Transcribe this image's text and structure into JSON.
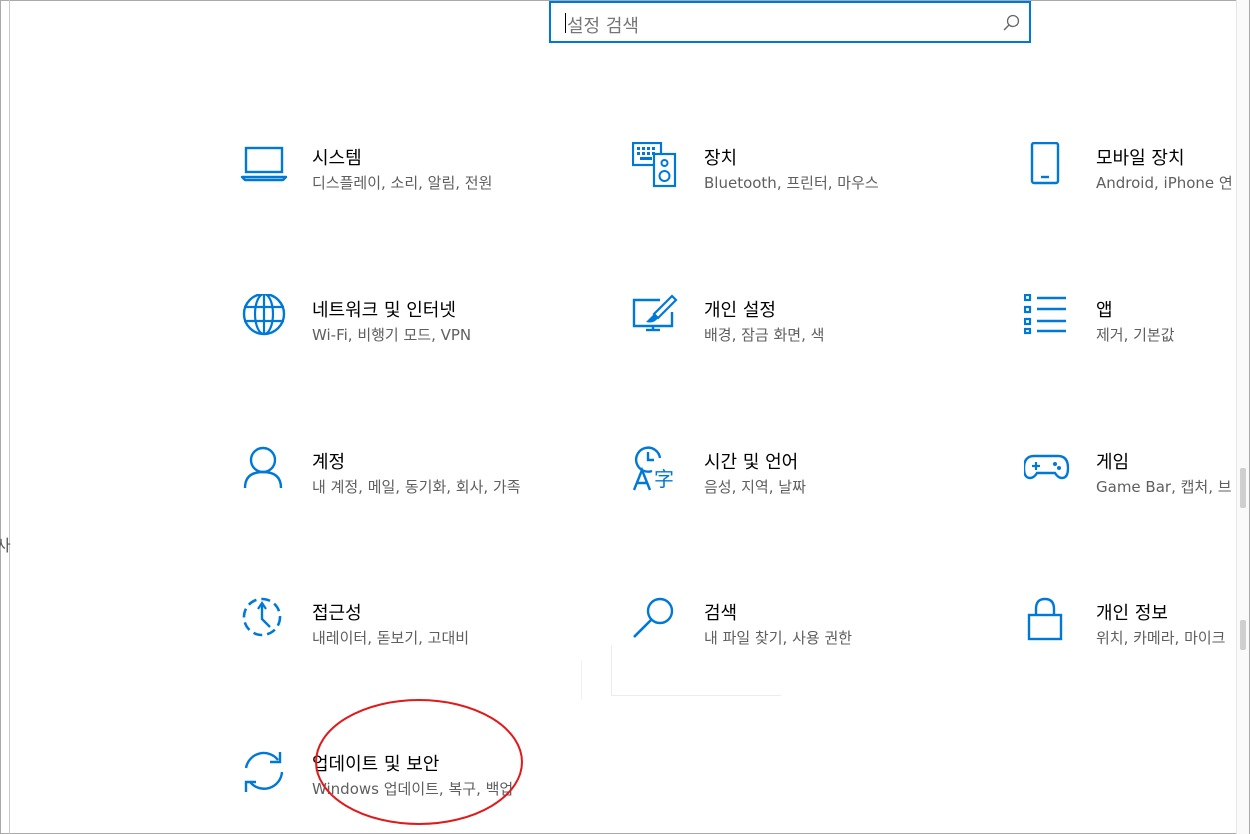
{
  "search": {
    "placeholder": "설정 검색"
  },
  "left_clipped_text": "사",
  "tiles": [
    {
      "title": "시스템",
      "subtitle": "디스플레이, 소리, 알림, 전원"
    },
    {
      "title": "장치",
      "subtitle": "Bluetooth, 프린터, 마우스"
    },
    {
      "title": "모바일 장치",
      "subtitle": "Android, iPhone 연"
    },
    {
      "title": "네트워크 및 인터넷",
      "subtitle": "Wi-Fi, 비행기 모드, VPN"
    },
    {
      "title": "개인 설정",
      "subtitle": "배경, 잠금 화면, 색"
    },
    {
      "title": "앱",
      "subtitle": "제거, 기본값"
    },
    {
      "title": "계정",
      "subtitle": "내 계정, 메일, 동기화, 회사, 가족"
    },
    {
      "title": "시간 및 언어",
      "subtitle": "음성, 지역, 날짜"
    },
    {
      "title": "게임",
      "subtitle": "Game Bar, 캡처, 브"
    },
    {
      "title": "접근성",
      "subtitle": "내레이터, 돋보기, 고대비"
    },
    {
      "title": "검색",
      "subtitle": "내 파일 찾기, 사용 권한"
    },
    {
      "title": "개인 정보",
      "subtitle": "위치, 카메라, 마이크"
    },
    {
      "title": "업데이트 및 보안",
      "subtitle": "Windows 업데이트, 복구, 백업"
    }
  ],
  "icons": [
    "laptop-icon",
    "keyboard-speaker-icon",
    "phone-icon",
    "globe-icon",
    "paint-screen-icon",
    "apps-list-icon",
    "person-icon",
    "time-language-icon",
    "gamepad-icon",
    "ease-of-access-icon",
    "search-icon",
    "lock-icon",
    "sync-icon"
  ],
  "colors": {
    "accent": "#0078d7",
    "annotation": "#e0191b"
  }
}
